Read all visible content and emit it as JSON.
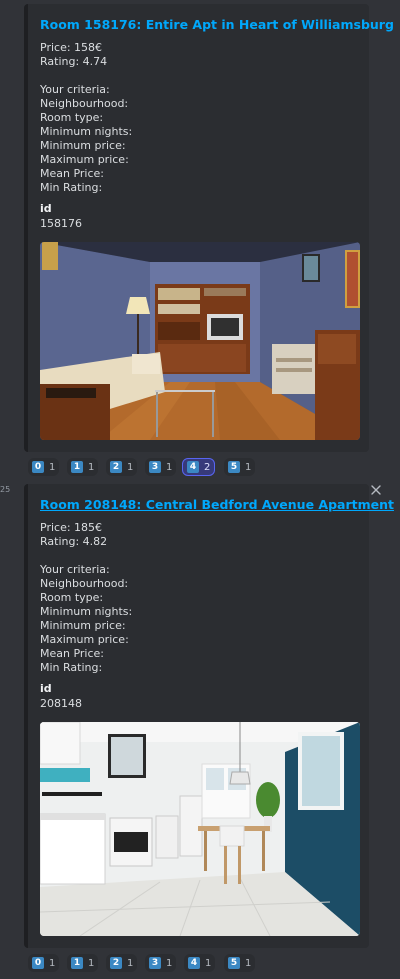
{
  "messages": [
    {
      "title": "Room 158176: Entire Apt in Heart of Williamsburg",
      "price": "Price: 158€",
      "rating": "Rating: 4.74",
      "criteria_header": "Your criteria:",
      "criteria": [
        "Neighbourhood:",
        "Room type:",
        "Minimum nights:",
        "Minimum price:",
        "Maximum price:",
        "Mean Price:",
        "Min Rating:"
      ],
      "field_name": "id",
      "field_value": "158176",
      "reactions": [
        {
          "key": "0",
          "count": "1",
          "active": false
        },
        {
          "key": "1",
          "count": "1",
          "active": false
        },
        {
          "key": "2",
          "count": "1",
          "active": false
        },
        {
          "key": "3",
          "count": "1",
          "active": false
        },
        {
          "key": "4",
          "count": "2",
          "active": true
        },
        {
          "key": "5",
          "count": "1",
          "active": false
        }
      ]
    },
    {
      "timestamp": "25",
      "title": "Room 208148: Central Bedford Avenue Apartment",
      "price": "Price: 185€",
      "rating": "Rating: 4.82",
      "criteria_header": "Your criteria:",
      "criteria": [
        "Neighbourhood:",
        "Room type:",
        "Minimum nights:",
        "Minimum price:",
        "Maximum price:",
        "Mean Price:",
        "Min Rating:"
      ],
      "field_name": "id",
      "field_value": "208148",
      "reactions": [
        {
          "key": "0",
          "count": "1",
          "active": false
        },
        {
          "key": "1",
          "count": "1",
          "active": false
        },
        {
          "key": "2",
          "count": "1",
          "active": false
        },
        {
          "key": "3",
          "count": "1",
          "active": false
        },
        {
          "key": "4",
          "count": "1",
          "active": false
        },
        {
          "key": "5",
          "count": "1",
          "active": false
        }
      ]
    }
  ],
  "colors": {
    "link": "#00a8fc",
    "keycap": "#3b88c3",
    "active_reaction_border": "#5865f2"
  }
}
